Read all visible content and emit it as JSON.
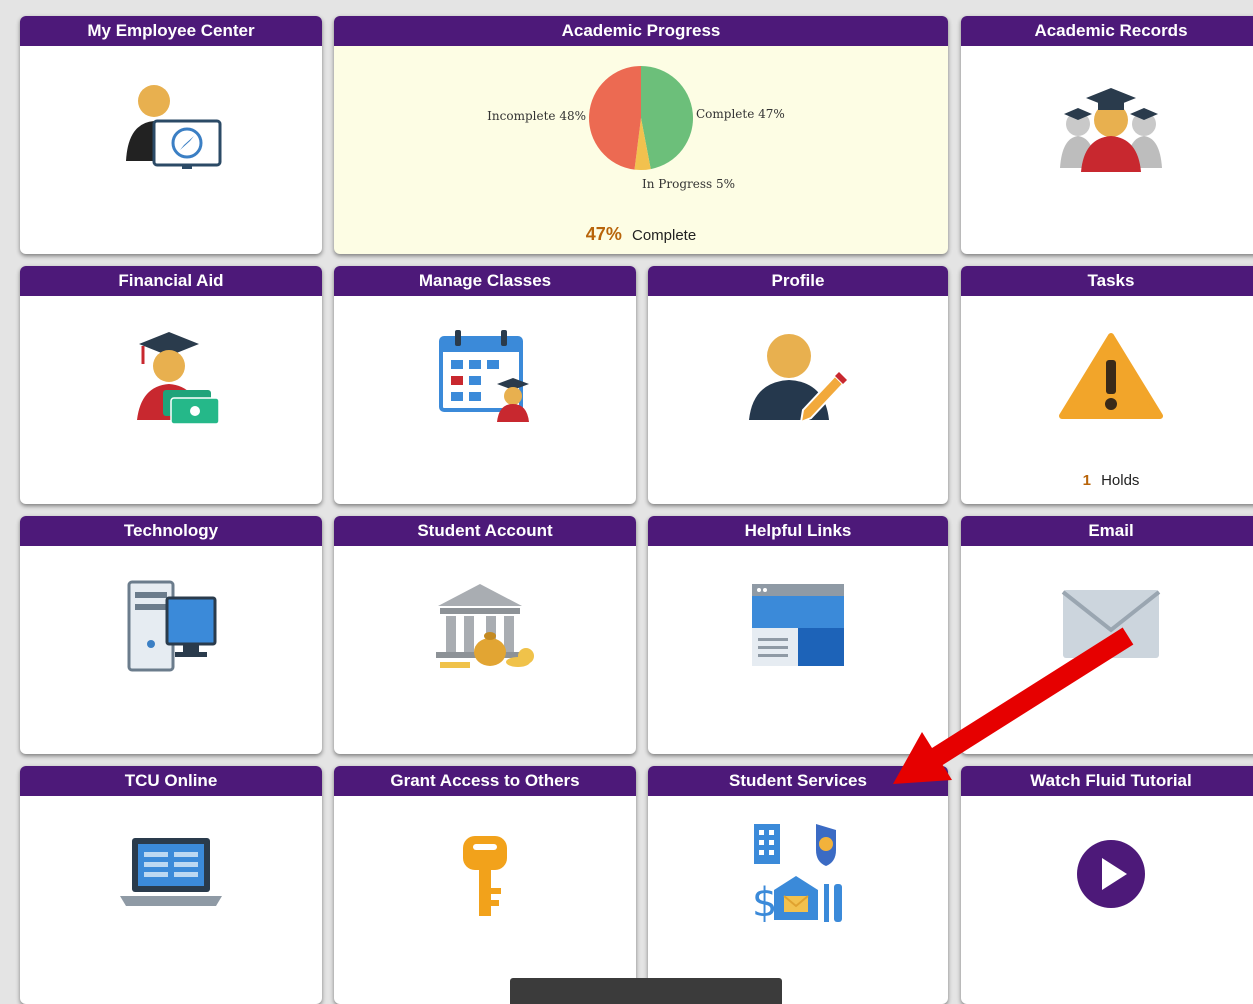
{
  "tiles": {
    "my_employee_center": {
      "title": "My Employee Center",
      "icon": "employee-compass-icon"
    },
    "academic_progress": {
      "title": "Academic Progress",
      "percent": "47%",
      "percent_label": "Complete"
    },
    "academic_records": {
      "title": "Academic Records",
      "icon": "graduates-icon"
    },
    "financial_aid": {
      "title": "Financial Aid",
      "icon": "graduate-money-icon"
    },
    "manage_classes": {
      "title": "Manage Classes",
      "icon": "calendar-student-icon"
    },
    "profile": {
      "title": "Profile",
      "icon": "user-pencil-icon"
    },
    "tasks": {
      "title": "Tasks",
      "icon": "warning-icon",
      "count": "1",
      "count_label": "Holds"
    },
    "technology": {
      "title": "Technology",
      "icon": "desktop-computer-icon"
    },
    "student_account": {
      "title": "Student Account",
      "icon": "bank-money-icon"
    },
    "helpful_links": {
      "title": "Helpful Links",
      "icon": "browser-window-icon"
    },
    "email": {
      "title": "Email",
      "icon": "envelope-icon"
    },
    "tcu_online": {
      "title": "TCU Online",
      "icon": "laptop-icon"
    },
    "grant_access": {
      "title": "Grant Access to Others",
      "icon": "key-icon"
    },
    "student_services": {
      "title": "Student Services",
      "icon": "campus-services-icon"
    },
    "watch_tutorial": {
      "title": "Watch Fluid Tutorial",
      "icon": "play-icon"
    }
  },
  "chart_data": {
    "type": "pie",
    "slices": [
      {
        "label": "Complete 47%",
        "value": 47,
        "color": "#6cbf7a"
      },
      {
        "label": "In Progress 5%",
        "value": 5,
        "color": "#f2c14e"
      },
      {
        "label": "Incomplete 48%",
        "value": 48,
        "color": "#ec6a52"
      }
    ]
  },
  "colors": {
    "header": "#4d1979",
    "annotation_arrow": "#e60000",
    "percent_accent": "#b8640a"
  }
}
